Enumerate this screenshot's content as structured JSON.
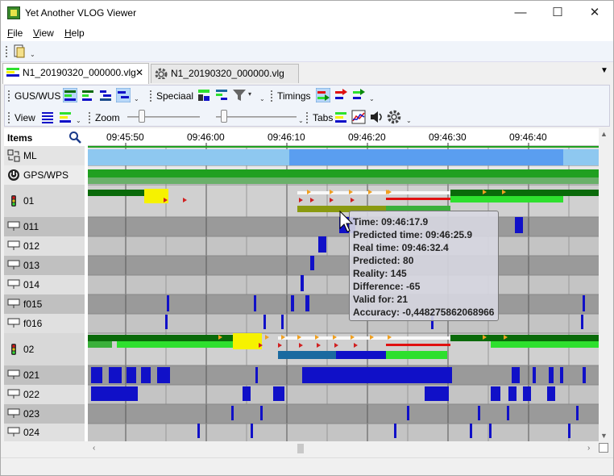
{
  "window": {
    "title": "Yet Another VLOG Viewer",
    "minimize_glyph": "—",
    "maximize_glyph": "☐",
    "close_glyph": "✕"
  },
  "menu": {
    "items": [
      {
        "label_ul": "F",
        "label_rest": "ile"
      },
      {
        "label_ul": "V",
        "label_rest": "iew"
      },
      {
        "label_ul": "H",
        "label_rest": "elp"
      }
    ]
  },
  "tabs": [
    {
      "label": "N1_20190320_000000.vlg",
      "close": "✕",
      "active": true
    },
    {
      "label": "N1_20190320_000000.vlg",
      "active": false
    }
  ],
  "tab_menu_glyph": "▼",
  "toolbar": {
    "gus_wus": "GUS/WUS",
    "speciaal": "Speciaal",
    "timings": "Timings",
    "view": "View",
    "zoom": "Zoom",
    "tabs": "Tabs"
  },
  "grid": {
    "items_header": "Items",
    "time_ticks": [
      "09:45:50",
      "09:46:00",
      "09:46:10",
      "09:46:20",
      "09:46:30",
      "09:46:40"
    ],
    "rows": [
      {
        "label": "ML",
        "icon": "ml-icon"
      },
      {
        "label": "GPS/WPS",
        "icon": "power-icon"
      },
      {
        "label": "01",
        "icon": "traffic-light-icon"
      },
      {
        "label": "011",
        "icon": "detector-icon"
      },
      {
        "label": "012",
        "icon": "detector-icon"
      },
      {
        "label": "013",
        "icon": "detector-icon"
      },
      {
        "label": "014",
        "icon": "detector-icon"
      },
      {
        "label": "f015",
        "icon": "detector-icon"
      },
      {
        "label": "f016",
        "icon": "detector-icon"
      },
      {
        "label": "02",
        "icon": "traffic-light-icon"
      },
      {
        "label": "021",
        "icon": "detector-icon"
      },
      {
        "label": "022",
        "icon": "detector-icon"
      },
      {
        "label": "023",
        "icon": "detector-icon"
      },
      {
        "label": "024",
        "icon": "detector-icon"
      }
    ]
  },
  "tooltip": {
    "lines": [
      "Time: 09:46:17.9",
      "Predicted time: 09:46:25.9",
      "Real time: 09:46:32.4",
      "Predicted: 80",
      "Reality: 145",
      "Difference: -65",
      "Valid for: 21",
      "Accuracy: -0,448275862068966"
    ]
  },
  "colors": {
    "dark_green": "#0a6a0a",
    "light_green": "#2ee02e",
    "yellow": "#f6f200",
    "red": "#e01010",
    "blue": "#1010c8",
    "light_blue": "#8ec8f0",
    "mid_blue": "#5a9ef0",
    "olive": "#8a9a10",
    "teal": "#1a6aa0"
  }
}
